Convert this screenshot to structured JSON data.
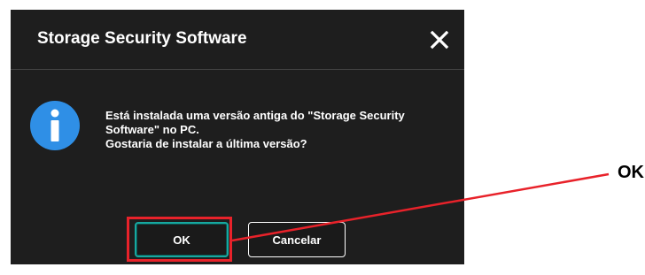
{
  "dialog": {
    "title": "Storage Security Software",
    "close_icon": "close-icon",
    "info_icon": "info-icon",
    "message_lines": [
      "Está instalada uma versão antiga do \"Storage Security",
      "Software\" no PC.",
      "Gostaria de instalar a última versão?"
    ],
    "ok_label": "OK",
    "cancel_label": "Cancelar"
  },
  "annotation": {
    "label": "OK",
    "highlight_color": "#e8222a"
  },
  "colors": {
    "dialog_background": "#1e1e1e",
    "info_icon_blue": "#2f8fe6",
    "ok_border": "#17a8a0",
    "callout_red": "#e8222a"
  }
}
